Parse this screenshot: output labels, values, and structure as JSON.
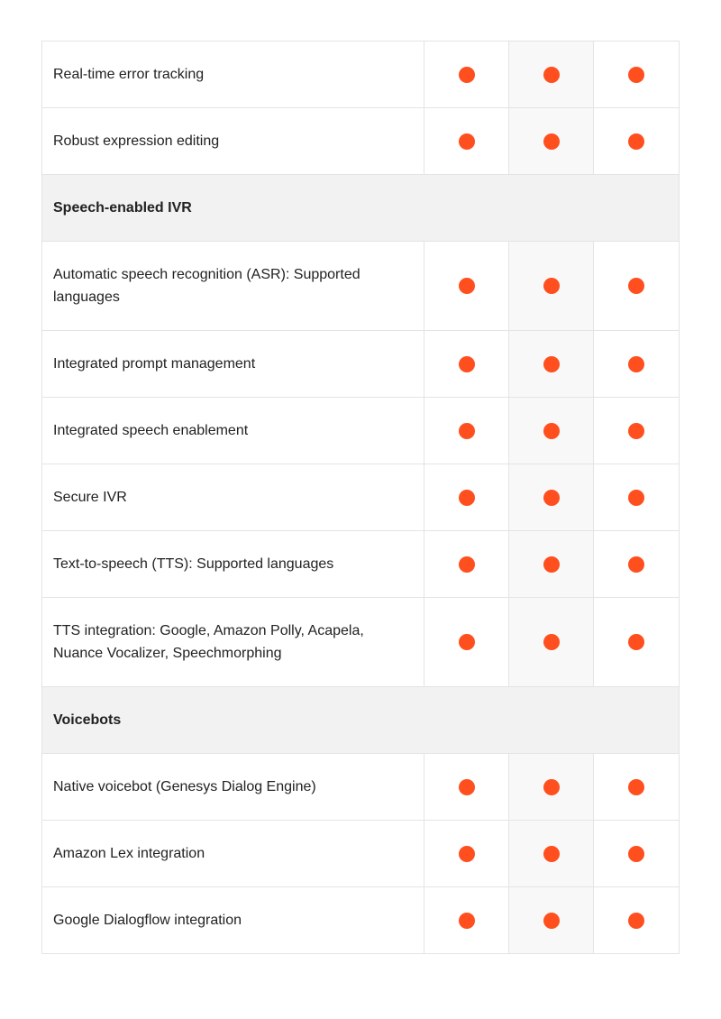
{
  "colors": {
    "dot": "#ff4f1f",
    "section_bg": "#f2f2f2",
    "shaded_column_bg": "#f8f8f8",
    "border": "#e4e4e4"
  },
  "icons": {
    "feature_included": "filled-circle-icon"
  },
  "rows_top": [
    {
      "label": "Real-time error tracking",
      "cols": [
        true,
        true,
        true
      ]
    },
    {
      "label": "Robust expression editing",
      "cols": [
        true,
        true,
        true
      ]
    }
  ],
  "section_speech": {
    "title": "Speech-enabled IVR",
    "rows": [
      {
        "label": "Automatic speech recognition (ASR): Supported languages",
        "cols": [
          true,
          true,
          true
        ]
      },
      {
        "label": "Integrated prompt management",
        "cols": [
          true,
          true,
          true
        ]
      },
      {
        "label": "Integrated speech enablement",
        "cols": [
          true,
          true,
          true
        ]
      },
      {
        "label": "Secure IVR",
        "cols": [
          true,
          true,
          true
        ]
      },
      {
        "label": "Text-to-speech (TTS): Supported languages",
        "cols": [
          true,
          true,
          true
        ]
      },
      {
        "label": "TTS integration: Google, Amazon Polly, Acapela, Nuance Vocalizer, Speechmorphing",
        "cols": [
          true,
          true,
          true
        ]
      }
    ]
  },
  "section_voicebots": {
    "title": "Voicebots",
    "rows": [
      {
        "label": "Native voicebot (Genesys Dialog Engine)",
        "cols": [
          true,
          true,
          true
        ]
      },
      {
        "label": "Amazon Lex integration",
        "cols": [
          true,
          true,
          true
        ]
      },
      {
        "label": "Google Dialogflow integration",
        "cols": [
          true,
          true,
          true
        ]
      }
    ]
  }
}
